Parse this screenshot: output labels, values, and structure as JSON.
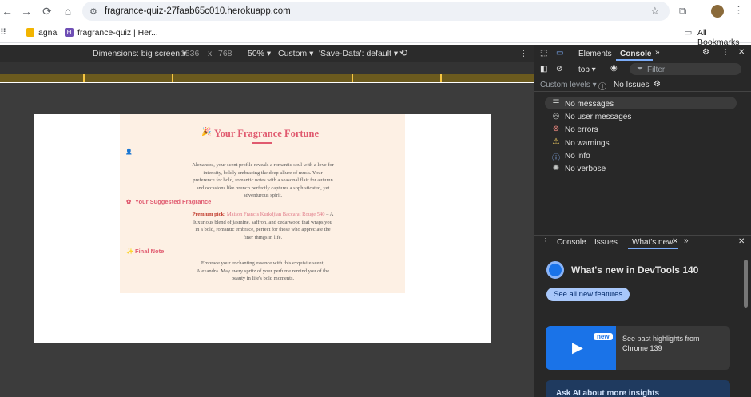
{
  "browser": {
    "url": "fragrance-quiz-27faab65c010.herokuapp.com",
    "bookmarks": [
      {
        "label": "agna"
      },
      {
        "label": "fragrance-quiz | Her..."
      }
    ],
    "all_bookmarks": "All Bookmarks"
  },
  "device_toolbar": {
    "dimensions_label": "Dimensions: big screen",
    "width": "1536",
    "times": "x",
    "height": "768",
    "zoom": "50%",
    "throttle": "Custom",
    "save_data": "'Save-Data': default"
  },
  "page": {
    "title_emoji": "🎉",
    "title": "Your Fragrance Fortune",
    "intro_icon": "👤",
    "intro": "Alexandra, your scent profile reveals a romantic soul with a love for intensity, boldly embracing the deep allure of musk. Your preference for bold, romantic notes with a seasonal flair for autumn and occasions like brunch perfectly captures a sophisticated, yet adventurous spirit.",
    "suggested_heading": "Your Suggested Fragrance",
    "suggested_label": "Premium pick:",
    "suggested_name": "Maison Francis Kurkdjian Baccarat Rouge 540",
    "suggested_desc": "– A luxurious blend of jasmine, saffron, and cedarwood that wraps you in a bold, romantic embrace, perfect for those who appreciate the finer things in life.",
    "final_heading": "Final Note",
    "final_text": "Embrace your enchanting essence with this exquisite scent, Alexandra. May every spritz of your perfume remind you of the beauty in life's bold moments."
  },
  "devtools": {
    "tabs": [
      "Elements",
      "Console"
    ],
    "context": "top",
    "filter_placeholder": "Filter",
    "levels": "Custom levels",
    "issues": "No Issues",
    "messages": [
      {
        "label": "No messages",
        "icon": "list-icon"
      },
      {
        "label": "No user messages",
        "icon": "user-icon"
      },
      {
        "label": "No errors",
        "icon": "error-icon"
      },
      {
        "label": "No warnings",
        "icon": "warning-icon"
      },
      {
        "label": "No info",
        "icon": "info-icon"
      },
      {
        "label": "No verbose",
        "icon": "bug-icon"
      }
    ],
    "drawer_tabs": [
      "Console",
      "Issues",
      "What's new"
    ],
    "whats_new_title": "What's new in DevTools 140",
    "see_all": "See all new features",
    "highlight_badge": "new",
    "highlight_text": "See past highlights from Chrome 139",
    "ask_ai": "Ask AI about more insights"
  }
}
